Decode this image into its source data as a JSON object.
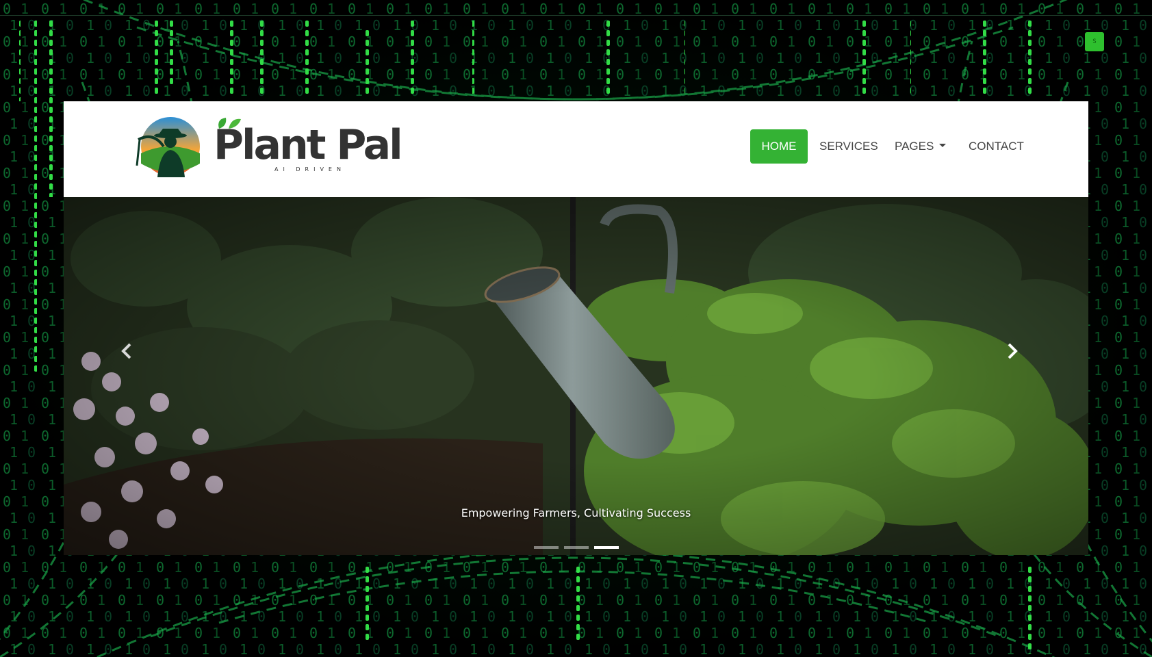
{
  "page": {
    "background_theme": "green binary matrix",
    "accent_color": "#34b234"
  },
  "corner_badge": {
    "label": "S"
  },
  "logo": {
    "name": "Plant Pal",
    "tagline": "AI DRIVEN",
    "icon": "farmer-emblem-icon"
  },
  "nav": {
    "items": [
      {
        "label": "HOME",
        "active": true
      },
      {
        "label": "SERVICES",
        "active": false
      },
      {
        "label": "PAGES",
        "active": false,
        "dropdown": true
      },
      {
        "label": "CONTACT",
        "active": false
      }
    ]
  },
  "carousel": {
    "caption": "Empowering Farmers, Cultivating Success",
    "prev_icon": "chevron-left-icon",
    "next_icon": "chevron-right-icon",
    "slide_count": 3,
    "active_slide": 3
  }
}
